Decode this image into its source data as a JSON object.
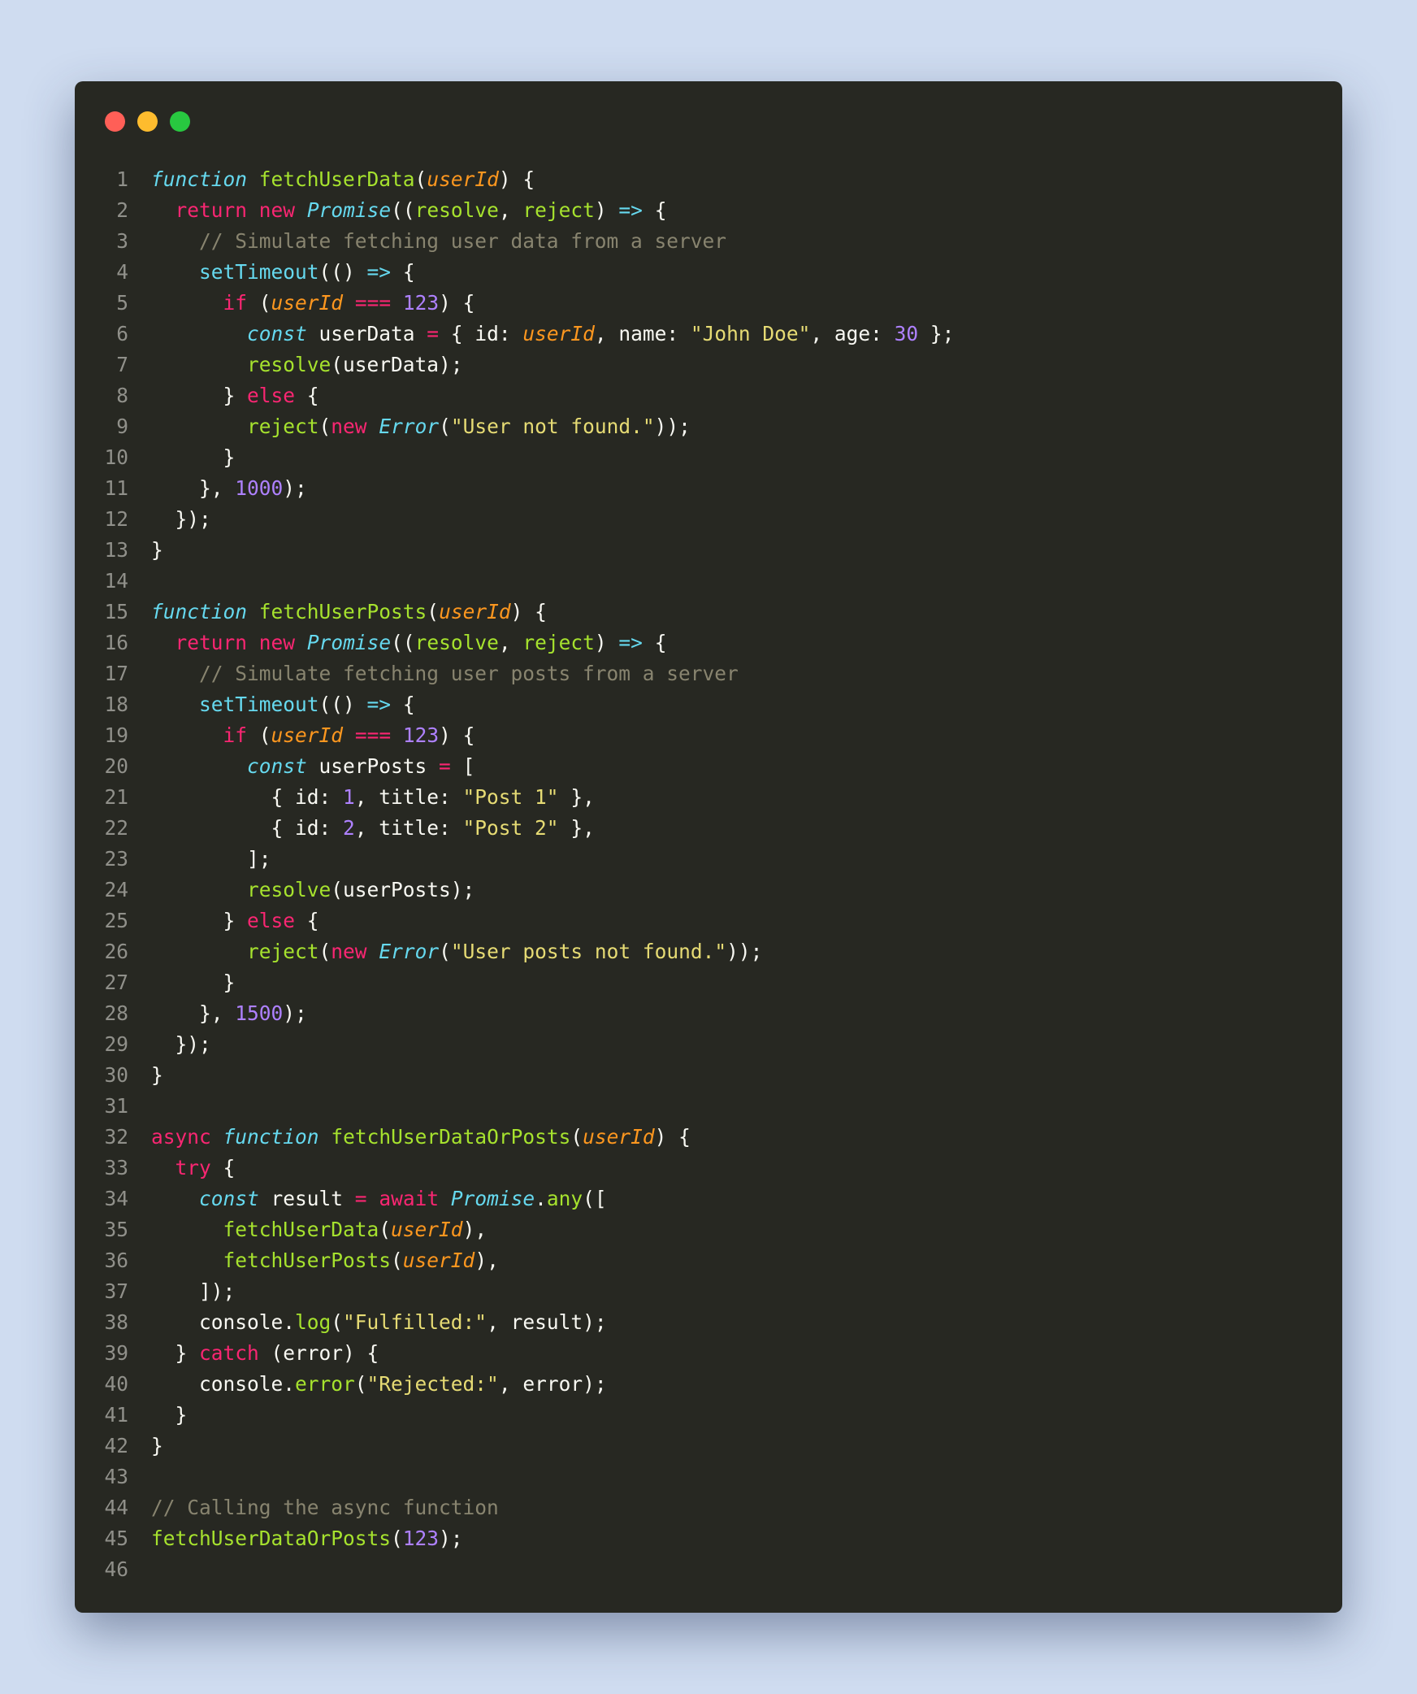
{
  "window": {
    "controls": [
      "close",
      "minimize",
      "maximize"
    ],
    "colors": {
      "close": "#ff5f57",
      "minimize": "#febc2e",
      "maximize": "#28c840"
    }
  },
  "editor": {
    "theme": "monokai",
    "lines": [
      [
        [
          "function",
          "st"
        ],
        [
          " "
        ],
        [
          "fetchUserData",
          "fn"
        ],
        [
          "("
        ],
        [
          "userId",
          "pa"
        ],
        [
          ") {"
        ]
      ],
      [
        [
          "  "
        ],
        [
          "return",
          "kw"
        ],
        [
          " "
        ],
        [
          "new",
          "kw"
        ],
        [
          " "
        ],
        [
          "Promise",
          "cl"
        ],
        [
          "(("
        ],
        [
          "resolve",
          "fn"
        ],
        [
          ", "
        ],
        [
          "reject",
          "fn"
        ],
        [
          ") "
        ],
        [
          "=>",
          "ar"
        ],
        [
          " {"
        ]
      ],
      [
        [
          "    "
        ],
        [
          "// Simulate fetching user data from a server",
          "cm"
        ]
      ],
      [
        [
          "    "
        ],
        [
          "setTimeout",
          "bi"
        ],
        [
          "(() "
        ],
        [
          "=>",
          "ar"
        ],
        [
          " {"
        ]
      ],
      [
        [
          "      "
        ],
        [
          "if",
          "kw"
        ],
        [
          " ("
        ],
        [
          "userId",
          "pa"
        ],
        [
          " "
        ],
        [
          "===",
          "op"
        ],
        [
          " "
        ],
        [
          "123",
          "num"
        ],
        [
          ") {"
        ]
      ],
      [
        [
          "        "
        ],
        [
          "const",
          "st"
        ],
        [
          " userData "
        ],
        [
          "=",
          "op"
        ],
        [
          " { id: "
        ],
        [
          "userId",
          "pa"
        ],
        [
          ", name: "
        ],
        [
          "\"John Doe\"",
          "str"
        ],
        [
          ", age: "
        ],
        [
          "30",
          "num"
        ],
        [
          " };"
        ]
      ],
      [
        [
          "        "
        ],
        [
          "resolve",
          "fn"
        ],
        [
          "(userData);"
        ]
      ],
      [
        [
          "      } "
        ],
        [
          "else",
          "kw"
        ],
        [
          " {"
        ]
      ],
      [
        [
          "        "
        ],
        [
          "reject",
          "fn"
        ],
        [
          "("
        ],
        [
          "new",
          "kw"
        ],
        [
          " "
        ],
        [
          "Error",
          "cl"
        ],
        [
          "("
        ],
        [
          "\"User not found.\"",
          "str"
        ],
        [
          "));"
        ]
      ],
      [
        [
          "      }"
        ]
      ],
      [
        [
          "    }, "
        ],
        [
          "1000",
          "num"
        ],
        [
          ");"
        ]
      ],
      [
        [
          "  });"
        ]
      ],
      [
        [
          "}"
        ]
      ],
      [
        [
          ""
        ]
      ],
      [
        [
          "function",
          "st"
        ],
        [
          " "
        ],
        [
          "fetchUserPosts",
          "fn"
        ],
        [
          "("
        ],
        [
          "userId",
          "pa"
        ],
        [
          ") {"
        ]
      ],
      [
        [
          "  "
        ],
        [
          "return",
          "kw"
        ],
        [
          " "
        ],
        [
          "new",
          "kw"
        ],
        [
          " "
        ],
        [
          "Promise",
          "cl"
        ],
        [
          "(("
        ],
        [
          "resolve",
          "fn"
        ],
        [
          ", "
        ],
        [
          "reject",
          "fn"
        ],
        [
          ") "
        ],
        [
          "=>",
          "ar"
        ],
        [
          " {"
        ]
      ],
      [
        [
          "    "
        ],
        [
          "// Simulate fetching user posts from a server",
          "cm"
        ]
      ],
      [
        [
          "    "
        ],
        [
          "setTimeout",
          "bi"
        ],
        [
          "(() "
        ],
        [
          "=>",
          "ar"
        ],
        [
          " {"
        ]
      ],
      [
        [
          "      "
        ],
        [
          "if",
          "kw"
        ],
        [
          " ("
        ],
        [
          "userId",
          "pa"
        ],
        [
          " "
        ],
        [
          "===",
          "op"
        ],
        [
          " "
        ],
        [
          "123",
          "num"
        ],
        [
          ") {"
        ]
      ],
      [
        [
          "        "
        ],
        [
          "const",
          "st"
        ],
        [
          " userPosts "
        ],
        [
          "=",
          "op"
        ],
        [
          " ["
        ]
      ],
      [
        [
          "          { id: "
        ],
        [
          "1",
          "num"
        ],
        [
          ", title: "
        ],
        [
          "\"Post 1\"",
          "str"
        ],
        [
          " },"
        ]
      ],
      [
        [
          "          { id: "
        ],
        [
          "2",
          "num"
        ],
        [
          ", title: "
        ],
        [
          "\"Post 2\"",
          "str"
        ],
        [
          " },"
        ]
      ],
      [
        [
          "        ];"
        ]
      ],
      [
        [
          "        "
        ],
        [
          "resolve",
          "fn"
        ],
        [
          "(userPosts);"
        ]
      ],
      [
        [
          "      } "
        ],
        [
          "else",
          "kw"
        ],
        [
          " {"
        ]
      ],
      [
        [
          "        "
        ],
        [
          "reject",
          "fn"
        ],
        [
          "("
        ],
        [
          "new",
          "kw"
        ],
        [
          " "
        ],
        [
          "Error",
          "cl"
        ],
        [
          "("
        ],
        [
          "\"User posts not found.\"",
          "str"
        ],
        [
          "));"
        ]
      ],
      [
        [
          "      }"
        ]
      ],
      [
        [
          "    }, "
        ],
        [
          "1500",
          "num"
        ],
        [
          ");"
        ]
      ],
      [
        [
          "  });"
        ]
      ],
      [
        [
          "}"
        ]
      ],
      [
        [
          ""
        ]
      ],
      [
        [
          "async",
          "kw"
        ],
        [
          " "
        ],
        [
          "function",
          "st"
        ],
        [
          " "
        ],
        [
          "fetchUserDataOrPosts",
          "fn"
        ],
        [
          "("
        ],
        [
          "userId",
          "pa"
        ],
        [
          ") {"
        ]
      ],
      [
        [
          "  "
        ],
        [
          "try",
          "kw"
        ],
        [
          " {"
        ]
      ],
      [
        [
          "    "
        ],
        [
          "const",
          "st"
        ],
        [
          " result "
        ],
        [
          "=",
          "op"
        ],
        [
          " "
        ],
        [
          "await",
          "kw"
        ],
        [
          " "
        ],
        [
          "Promise",
          "cl"
        ],
        [
          "."
        ],
        [
          "any",
          "fn"
        ],
        [
          "(["
        ]
      ],
      [
        [
          "      "
        ],
        [
          "fetchUserData",
          "fn"
        ],
        [
          "("
        ],
        [
          "userId",
          "pa"
        ],
        [
          "),"
        ]
      ],
      [
        [
          "      "
        ],
        [
          "fetchUserPosts",
          "fn"
        ],
        [
          "("
        ],
        [
          "userId",
          "pa"
        ],
        [
          "),"
        ]
      ],
      [
        [
          "    ]);"
        ]
      ],
      [
        [
          "    console."
        ],
        [
          "log",
          "fn"
        ],
        [
          "("
        ],
        [
          "\"Fulfilled:\"",
          "str"
        ],
        [
          ", result);"
        ]
      ],
      [
        [
          "  } "
        ],
        [
          "catch",
          "kw"
        ],
        [
          " (error) {"
        ]
      ],
      [
        [
          "    console."
        ],
        [
          "error",
          "fn"
        ],
        [
          "("
        ],
        [
          "\"Rejected:\"",
          "str"
        ],
        [
          ", error);"
        ]
      ],
      [
        [
          "  }"
        ]
      ],
      [
        [
          "}"
        ]
      ],
      [
        [
          ""
        ]
      ],
      [
        [
          "// Calling the async function",
          "cm"
        ]
      ],
      [
        [
          "fetchUserDataOrPosts",
          "fn"
        ],
        [
          "("
        ],
        [
          "123",
          "num"
        ],
        [
          ");"
        ]
      ],
      [
        [
          ""
        ]
      ]
    ]
  }
}
